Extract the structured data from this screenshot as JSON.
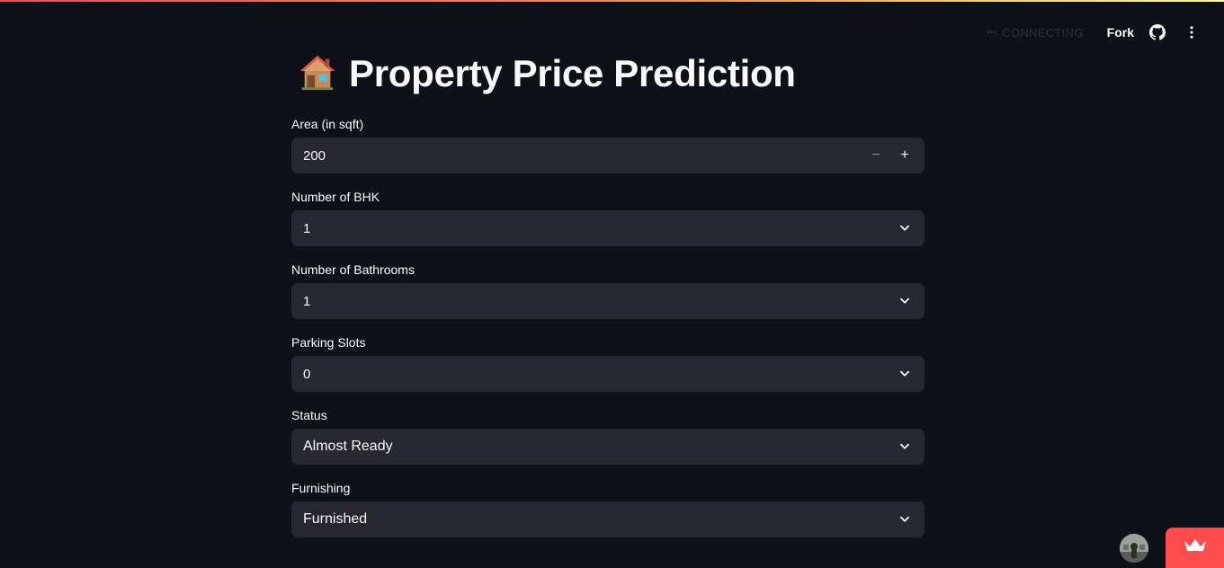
{
  "header": {
    "status_text": "CONNECTING",
    "fork_label": "Fork",
    "icons": [
      "github-icon",
      "kebab-menu-icon"
    ]
  },
  "page": {
    "title_emoji": "🏠",
    "title": "Property Price Prediction"
  },
  "form": {
    "area": {
      "label": "Area (in sqft)",
      "value": "200",
      "minus": "−",
      "plus": "+"
    },
    "bhk": {
      "label": "Number of BHK",
      "value": "1"
    },
    "bathrooms": {
      "label": "Number of Bathrooms",
      "value": "1"
    },
    "parking": {
      "label": "Parking Slots",
      "value": "0"
    },
    "status": {
      "label": "Status",
      "value": "Almost Ready"
    },
    "furnishing": {
      "label": "Furnishing",
      "value": "Furnished"
    }
  },
  "footer": {
    "badge_icon": "crown-icon",
    "avatar_icon": "user-avatar"
  },
  "colors": {
    "background": "#0e1117",
    "input_bg": "#262730",
    "accent": "#ff4b4b",
    "text": "#fafafa"
  }
}
